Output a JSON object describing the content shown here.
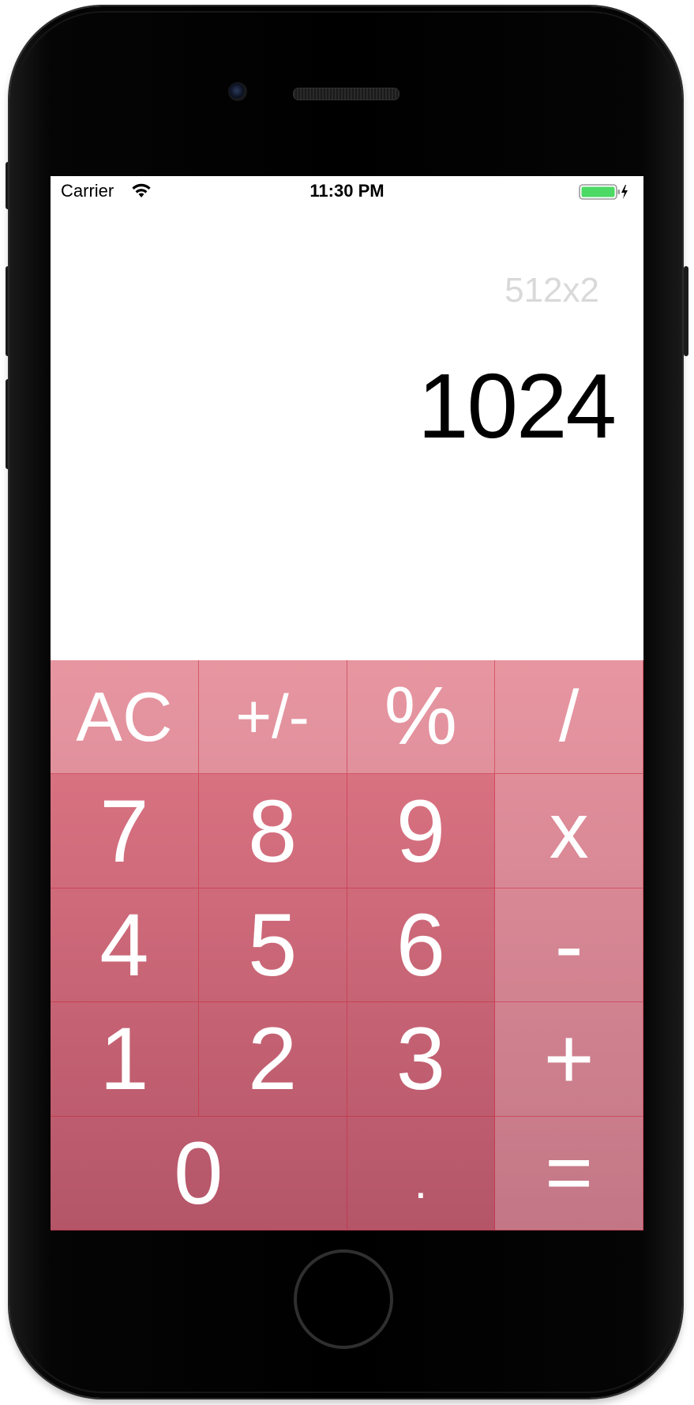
{
  "status_bar": {
    "carrier": "Carrier",
    "time": "11:30 PM",
    "battery_color": "#4cd964"
  },
  "display": {
    "expression": "512x2",
    "result": "1024"
  },
  "keypad": {
    "row1": [
      "AC",
      "+/-",
      "%",
      "/"
    ],
    "row2": [
      "7",
      "8",
      "9",
      "x"
    ],
    "row3": [
      "4",
      "5",
      "6",
      "-"
    ],
    "row4": [
      "1",
      "2",
      "3",
      "+"
    ],
    "row5": [
      "0",
      ".",
      "="
    ]
  },
  "theme": {
    "keypad_top_color": "#e17987",
    "keypad_bottom_color": "#b45568",
    "divider_color": "#c8283c"
  }
}
